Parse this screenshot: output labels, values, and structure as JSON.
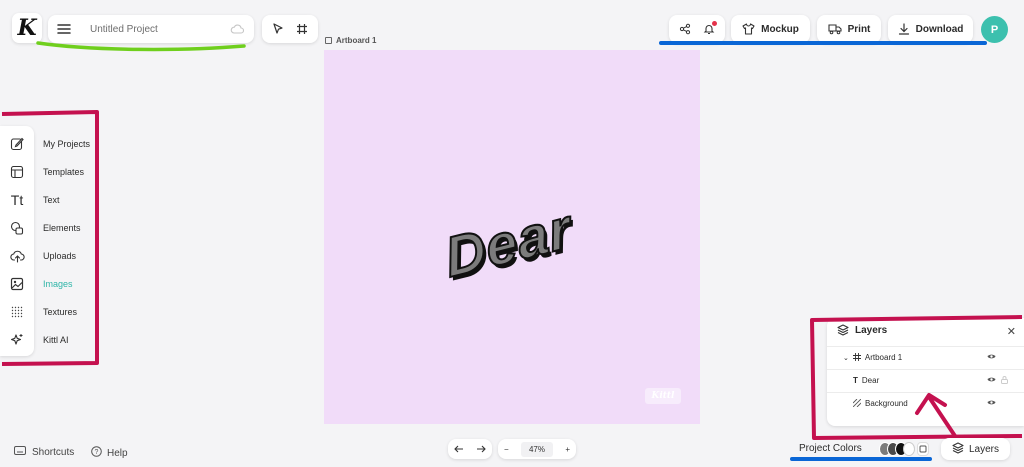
{
  "header": {
    "logo_letter": "K",
    "project_title": "Untitled Project",
    "mockup_label": "Mockup",
    "print_label": "Print",
    "download_label": "Download",
    "avatar_initial": "P"
  },
  "canvas": {
    "artboard_label": "Artboard 1",
    "text": "Dear",
    "watermark": "Kittl",
    "background_color": "#f1dcf9"
  },
  "sidebar": {
    "items": [
      {
        "label": "My Projects",
        "icon": "edit-icon"
      },
      {
        "label": "Templates",
        "icon": "templates-icon"
      },
      {
        "label": "Text",
        "icon": "text-icon"
      },
      {
        "label": "Elements",
        "icon": "elements-icon"
      },
      {
        "label": "Uploads",
        "icon": "upload-icon"
      },
      {
        "label": "Images",
        "icon": "image-icon",
        "active": true
      },
      {
        "label": "Textures",
        "icon": "textures-icon"
      },
      {
        "label": "Kittl AI",
        "icon": "sparkle-icon"
      }
    ]
  },
  "layers": {
    "title": "Layers",
    "rows": [
      {
        "name": "Artboard 1"
      },
      {
        "name": "Dear"
      },
      {
        "name": "Background"
      }
    ]
  },
  "footer": {
    "shortcuts_label": "Shortcuts",
    "help_label": "Help",
    "zoom": "47%",
    "project_colors_label": "Project Colors",
    "layers_toggle_label": "Layers"
  },
  "colors": {
    "accent": "#3cc0ae",
    "active_text": "#2fb5a8",
    "annotation_pink": "#c4114f",
    "annotation_green": "#6fcf1d",
    "annotation_blue": "#0a66d6",
    "swatches": [
      "#7c7c7c",
      "#4a4a4a",
      "#111111",
      "#ffffff"
    ]
  }
}
